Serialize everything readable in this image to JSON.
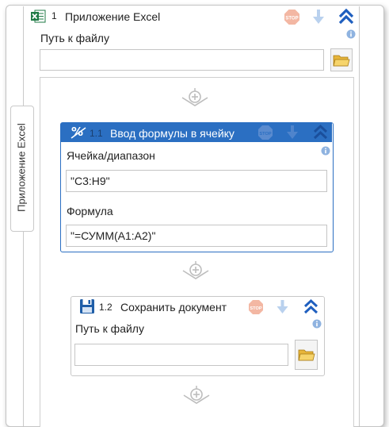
{
  "app_block": {
    "number": "1",
    "title": "Приложение Excel",
    "path_label": "Путь к файлу",
    "path_value": "",
    "side_tab_label": "Приложение Excel"
  },
  "formula_block": {
    "number": "1.1",
    "title": "Ввод формулы в ячейку",
    "cell_label": "Ячейка/диапазон",
    "cell_value": "\"C3:H9\"",
    "formula_label": "Формула",
    "formula_value": "\"=СУММ(A1:A2)\""
  },
  "save_block": {
    "number": "1.2",
    "title": "Сохранить документ",
    "path_label": "Путь к файлу",
    "path_value": ""
  },
  "icons": {
    "app": "excel-icon",
    "formula": "formula-icon",
    "save": "floppy-disk-icon",
    "stop": "stop-icon",
    "move_down": "arrow-down-icon",
    "collapse": "double-chevron-up-icon",
    "info": "info-icon",
    "folder": "folder-icon",
    "add_step": "add-step-icon"
  },
  "colors": {
    "accent_blue": "#2b6fc2",
    "collapse_icon": "#1f5fbf",
    "stop_icon": "#f3b7a3",
    "disabled_arrow": "#b9d1ee",
    "excel_green": "#1f7a45"
  }
}
